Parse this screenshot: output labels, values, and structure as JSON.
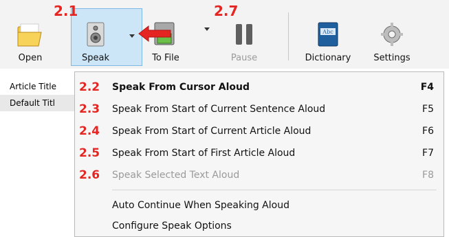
{
  "toolbar": {
    "buttons": [
      {
        "label": "Open",
        "icon": "folder-icon"
      },
      {
        "label": "Speak",
        "icon": "speaker-icon"
      },
      {
        "label": "To File",
        "icon": "save-to-file-icon"
      },
      {
        "label": "Pause",
        "icon": "pause-icon"
      },
      {
        "label": "Dictionary",
        "icon": "dictionary-icon"
      },
      {
        "label": "Settings",
        "icon": "gear-icon"
      }
    ]
  },
  "annotations": {
    "speak": "2.1",
    "pause": "2.7"
  },
  "left_panel": {
    "rows": [
      "Article Title",
      "Default Titl"
    ]
  },
  "speak_menu": {
    "items": [
      {
        "num": "2.2",
        "label": "Speak From Cursor Aloud",
        "key": "F4"
      },
      {
        "num": "2.3",
        "label": "Speak From Start of Current Sentence Aloud",
        "key": "F5"
      },
      {
        "num": "2.4",
        "label": "Speak From Start of Current Article Aloud",
        "key": "F6"
      },
      {
        "num": "2.5",
        "label": "Speak From Start of First Article Aloud",
        "key": "F7"
      },
      {
        "num": "2.6",
        "label": "Speak Selected Text Aloud",
        "key": "F8"
      }
    ],
    "extra_items": [
      {
        "label": "Auto Continue When Speaking Aloud"
      },
      {
        "label": "Configure Speak Options"
      }
    ]
  },
  "colors": {
    "annotation": "#e52521",
    "highlight": "#cde6f7"
  }
}
